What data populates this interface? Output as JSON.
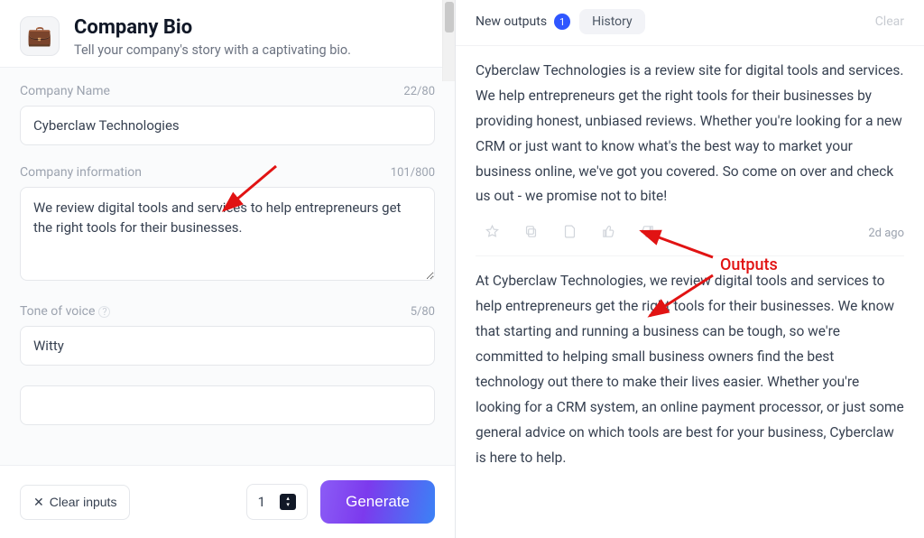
{
  "header": {
    "icon": "💼",
    "title": "Company Bio",
    "subtitle": "Tell your company's story with a captivating bio."
  },
  "fields": {
    "company_name": {
      "label": "Company Name",
      "count": "22/80",
      "value": "Cyberclaw Technologies"
    },
    "company_info": {
      "label": "Company information",
      "count": "101/800",
      "value": "We review digital tools and services to help entrepreneurs get the right tools for their businesses."
    },
    "tone": {
      "label": "Tone of voice",
      "count": "5/80",
      "value": "Witty"
    }
  },
  "footer": {
    "clear_label": "Clear inputs",
    "quantity": "1",
    "generate_label": "Generate"
  },
  "right": {
    "new_outputs_label": "New outputs",
    "new_outputs_badge": "1",
    "history_label": "History",
    "clear_label": "Clear",
    "timestamp": "2d ago",
    "output1": "Cyberclaw Technologies is a review site for digital tools and services. We help entrepreneurs get the right tools for their businesses by providing honest, unbiased reviews. Whether you're looking for a new CRM or just want to know what's the best way to market your business online, we've got you covered. So come on over and check us out - we promise not to bite!",
    "output2": "At Cyberclaw Technologies, we review digital tools and services to help entrepreneurs get the right tools for their businesses. We know that starting and running a business can be tough, so we're committed to helping small business owners find the best technology out there to make their lives easier. Whether you're looking for a CRM system, an online payment processor, or just some general advice on which tools are best for your business, Cyberclaw is here to help."
  },
  "annotation": {
    "label": "Outputs"
  }
}
